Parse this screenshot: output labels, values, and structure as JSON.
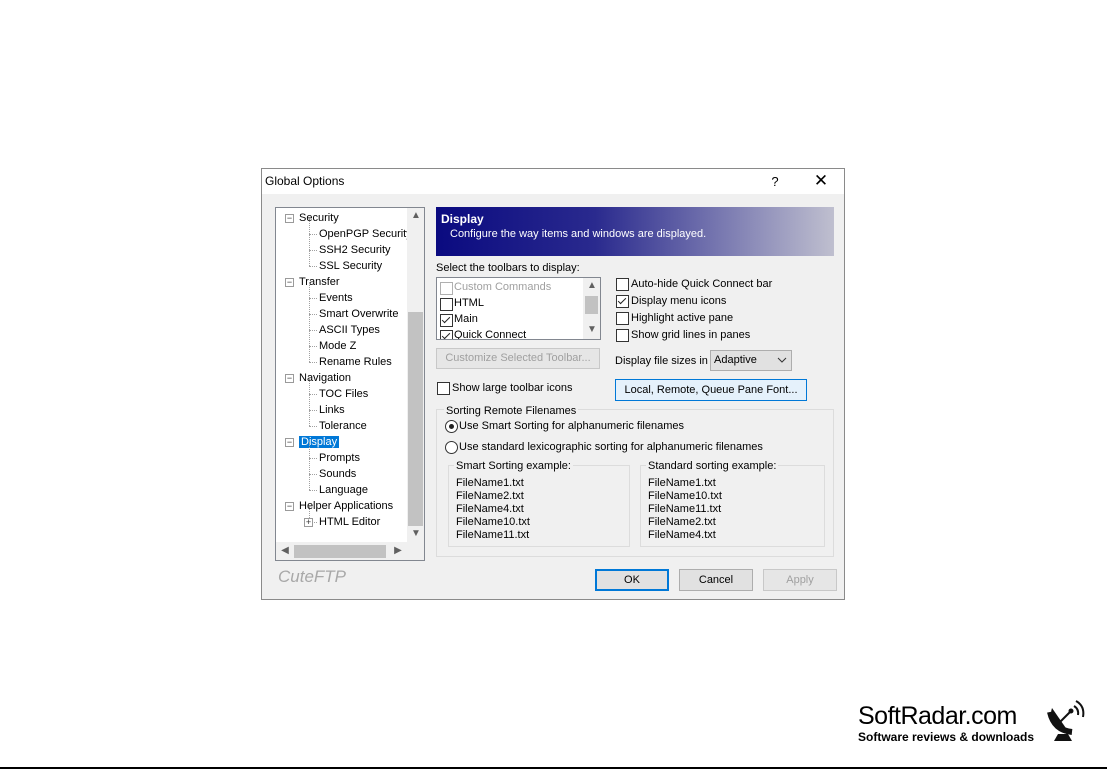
{
  "window": {
    "title": "Global Options",
    "help_glyph": "?",
    "close_glyph": "✕"
  },
  "tree": {
    "items": [
      {
        "label": "Security",
        "level": 0,
        "expander": "−"
      },
      {
        "label": "OpenPGP Security",
        "level": 1
      },
      {
        "label": "SSH2 Security",
        "level": 1
      },
      {
        "label": "SSL Security",
        "level": 1
      },
      {
        "label": "Transfer",
        "level": 0,
        "expander": "−"
      },
      {
        "label": "Events",
        "level": 1
      },
      {
        "label": "Smart Overwrite",
        "level": 1
      },
      {
        "label": "ASCII Types",
        "level": 1
      },
      {
        "label": "Mode Z",
        "level": 1
      },
      {
        "label": "Rename Rules",
        "level": 1
      },
      {
        "label": "Navigation",
        "level": 0,
        "expander": "−"
      },
      {
        "label": "TOC Files",
        "level": 1
      },
      {
        "label": "Links",
        "level": 1
      },
      {
        "label": "Tolerance",
        "level": 1
      },
      {
        "label": "Display",
        "level": 0,
        "expander": "−",
        "selected": true
      },
      {
        "label": "Prompts",
        "level": 1
      },
      {
        "label": "Sounds",
        "level": 1
      },
      {
        "label": "Language",
        "level": 1
      },
      {
        "label": "Helper Applications",
        "level": 0,
        "expander": "−"
      },
      {
        "label": "HTML Editor",
        "level": 1,
        "expander": "+"
      }
    ],
    "scroll_up": "▲",
    "scroll_down": "▼",
    "scroll_left": "◀",
    "scroll_right": "▶"
  },
  "brand_watermark": "CuteFTP",
  "header": {
    "title": "Display",
    "subtitle": "Configure the way items and windows are displayed."
  },
  "toolbars": {
    "label": "Select the toolbars to display:",
    "items": [
      {
        "label": "Custom Commands",
        "checked": false,
        "disabled": true
      },
      {
        "label": "HTML",
        "checked": false
      },
      {
        "label": "Main",
        "checked": true
      },
      {
        "label": "Quick Connect",
        "checked": true
      }
    ],
    "customize_button": "Customize Selected Toolbar...",
    "large_icons_label": "Show large toolbar icons",
    "large_icons_checked": false
  },
  "options": [
    {
      "label": "Auto-hide Quick Connect bar",
      "checked": false
    },
    {
      "label": "Display menu icons",
      "checked": true
    },
    {
      "label": "Highlight active pane",
      "checked": false
    },
    {
      "label": "Show grid lines in panes",
      "checked": false
    }
  ],
  "file_sizes": {
    "label": "Display file sizes in",
    "value": "Adaptive"
  },
  "font_button": "Local, Remote, Queue Pane Font...",
  "sorting": {
    "group_label": "Sorting Remote Filenames",
    "smart_label": "Use Smart Sorting for alphanumeric filenames",
    "standard_label": "Use standard lexicographic sorting for alphanumeric filenames",
    "selected": "smart",
    "smart_example": {
      "title": "Smart Sorting example:",
      "files": [
        "FileName1.txt",
        "FileName2.txt",
        "FileName4.txt",
        "FileName10.txt",
        "FileName11.txt"
      ]
    },
    "standard_example": {
      "title": "Standard sorting example:",
      "files": [
        "FileName1.txt",
        "FileName10.txt",
        "FileName11.txt",
        "FileName2.txt",
        "FileName4.txt"
      ]
    }
  },
  "buttons": {
    "ok": "OK",
    "cancel": "Cancel",
    "apply": "Apply"
  },
  "watermark": {
    "brand": "SoftRadar.com",
    "tagline": "Software reviews & downloads"
  },
  "colors": {
    "accent": "#0078d7",
    "banner_start": "#0a0a80",
    "banner_end": "#bfbfcf"
  }
}
